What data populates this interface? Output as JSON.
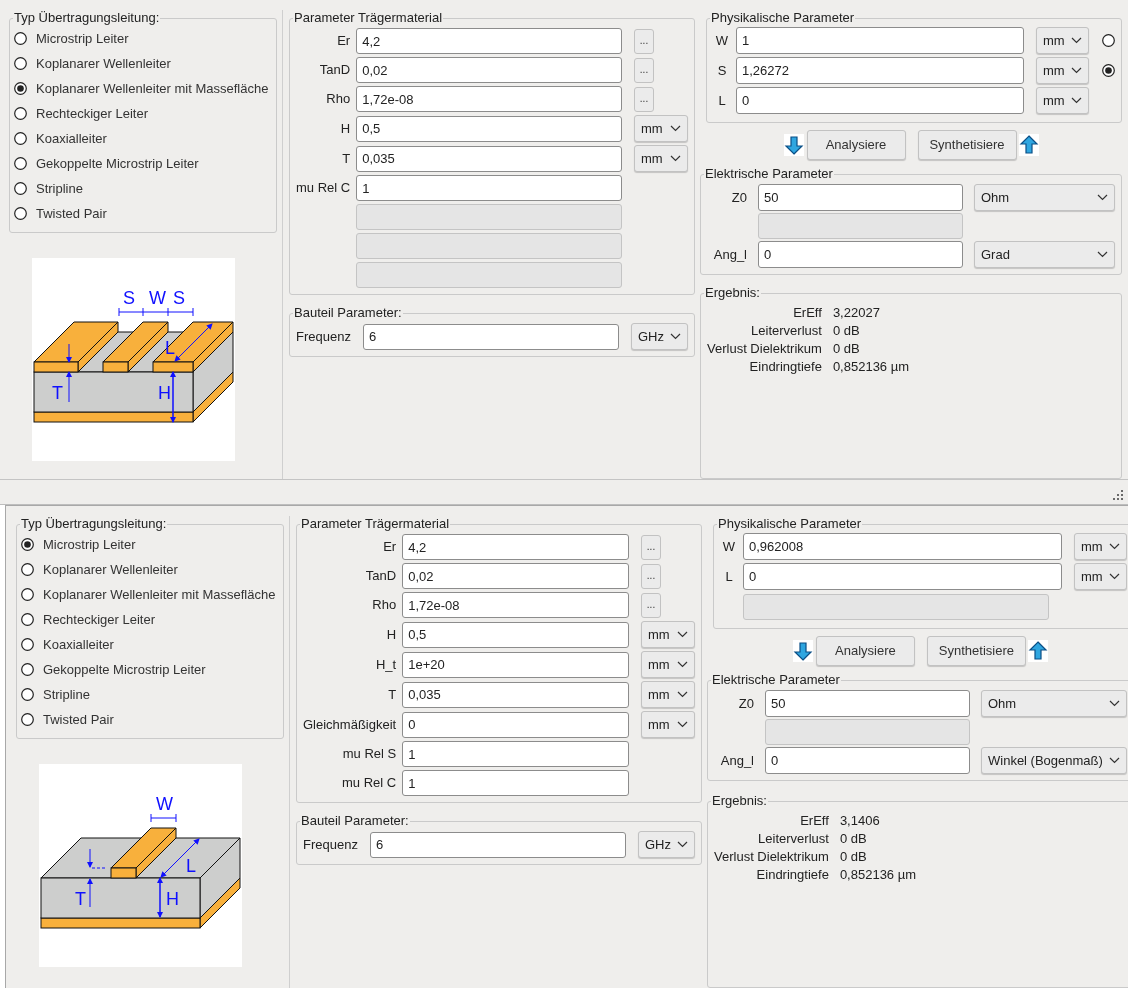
{
  "panels": [
    {
      "line_type": {
        "title": "Typ Übertragungsleitung:",
        "options": [
          {
            "label": "Microstrip Leiter",
            "selected": false
          },
          {
            "label": "Koplanarer Wellenleiter",
            "selected": false
          },
          {
            "label": "Koplanarer Wellenleiter mit Massefläche",
            "selected": true
          },
          {
            "label": "Rechteckiger Leiter",
            "selected": false
          },
          {
            "label": "Koaxialleiter",
            "selected": false
          },
          {
            "label": "Gekoppelte Microstrip Leiter",
            "selected": false
          },
          {
            "label": "Stripline",
            "selected": false
          },
          {
            "label": "Twisted Pair",
            "selected": false
          }
        ]
      },
      "diagram": {
        "kind": "coplanar",
        "s_left": "S",
        "w": "W",
        "s_right": "S",
        "l": "L",
        "t": "T",
        "h": "H"
      },
      "substrate": {
        "title": "Parameter Trägermaterial",
        "rows": [
          {
            "kind": "dots",
            "label": "Er",
            "value": "4,2",
            "button": "..."
          },
          {
            "kind": "dots",
            "label": "TanD",
            "value": "0,02",
            "button": "..."
          },
          {
            "kind": "dots",
            "label": "Rho",
            "value": "1,72e-08",
            "button": "..."
          },
          {
            "kind": "unit",
            "label": "H",
            "value": "0,5",
            "unit": "mm"
          },
          {
            "kind": "unit",
            "label": "T",
            "value": "0,035",
            "unit": "mm"
          },
          {
            "kind": "plain",
            "label": "mu Rel C",
            "value": "1"
          },
          {
            "kind": "blank"
          },
          {
            "kind": "blank"
          },
          {
            "kind": "blank"
          }
        ]
      },
      "component": {
        "title": "Bauteil Parameter:",
        "label": "Frequenz",
        "value": "6",
        "unit": "GHz"
      },
      "physical": {
        "title": "Physikalische Parameter",
        "rows": [
          {
            "kind": "field",
            "label": "W",
            "value": "1",
            "unit": "mm",
            "selected": false
          },
          {
            "kind": "field",
            "label": "S",
            "value": "1,26272",
            "unit": "mm",
            "selected": true
          },
          {
            "kind": "field",
            "label": "L",
            "value": "0",
            "unit": "mm"
          }
        ]
      },
      "actions": {
        "analyze": "Analysiere",
        "synthesize": "Synthetisiere"
      },
      "electrical": {
        "title": "Elektrische Parameter",
        "rows": [
          {
            "kind": "field",
            "label": "Z0",
            "value": "50",
            "unit": "Ohm"
          },
          {
            "kind": "blank"
          },
          {
            "kind": "field",
            "label": "Ang_l",
            "value": "0",
            "unit": "Grad"
          }
        ]
      },
      "results": {
        "title": "Ergebnis:",
        "rows": [
          {
            "label": "ErEff",
            "value": "3,22027"
          },
          {
            "label": "Leiterverlust",
            "value": "0 dB"
          },
          {
            "label": "Verlust Dielektrikum",
            "value": "0 dB"
          },
          {
            "label": "Eindringtiefe",
            "value": "0,852136 µm"
          }
        ]
      }
    },
    {
      "line_type": {
        "title": "Typ Übertragungsleitung:",
        "options": [
          {
            "label": "Microstrip Leiter",
            "selected": true
          },
          {
            "label": "Koplanarer Wellenleiter",
            "selected": false
          },
          {
            "label": "Koplanarer Wellenleiter mit Massefläche",
            "selected": false
          },
          {
            "label": "Rechteckiger Leiter",
            "selected": false
          },
          {
            "label": "Koaxialleiter",
            "selected": false
          },
          {
            "label": "Gekoppelte Microstrip Leiter",
            "selected": false
          },
          {
            "label": "Stripline",
            "selected": false
          },
          {
            "label": "Twisted Pair",
            "selected": false
          }
        ]
      },
      "diagram": {
        "kind": "microstrip",
        "w": "W",
        "l": "L",
        "t": "T",
        "h": "H"
      },
      "substrate": {
        "title": "Parameter Trägermaterial",
        "rows": [
          {
            "kind": "dots",
            "label": "Er",
            "value": "4,2",
            "button": "..."
          },
          {
            "kind": "dots",
            "label": "TanD",
            "value": "0,02",
            "button": "..."
          },
          {
            "kind": "dots",
            "label": "Rho",
            "value": "1,72e-08",
            "button": "..."
          },
          {
            "kind": "unit",
            "label": "H",
            "value": "0,5",
            "unit": "mm"
          },
          {
            "kind": "unit",
            "label": "H_t",
            "value": "1e+20",
            "unit": "mm"
          },
          {
            "kind": "unit",
            "label": "T",
            "value": "0,035",
            "unit": "mm"
          },
          {
            "kind": "unit",
            "label": "Gleichmäßigkeit",
            "value": "0",
            "unit": "mm"
          },
          {
            "kind": "plain",
            "label": "mu Rel S",
            "value": "1"
          },
          {
            "kind": "plain",
            "label": "mu Rel C",
            "value": "1"
          }
        ]
      },
      "component": {
        "title": "Bauteil Parameter:",
        "label": "Frequenz",
        "value": "6",
        "unit": "GHz"
      },
      "physical": {
        "title": "Physikalische Parameter",
        "rows": [
          {
            "kind": "field",
            "label": "W",
            "value": "0,962008",
            "unit": "mm"
          },
          {
            "kind": "field",
            "label": "L",
            "value": "0",
            "unit": "mm"
          },
          {
            "kind": "blank"
          }
        ]
      },
      "actions": {
        "analyze": "Analysiere",
        "synthesize": "Synthetisiere"
      },
      "electrical": {
        "title": "Elektrische Parameter",
        "rows": [
          {
            "kind": "field",
            "label": "Z0",
            "value": "50",
            "unit": "Ohm"
          },
          {
            "kind": "blank"
          },
          {
            "kind": "field",
            "label": "Ang_l",
            "value": "0",
            "unit": "Winkel (Bogenmaß)"
          }
        ]
      },
      "results": {
        "title": "Ergebnis:",
        "rows": [
          {
            "label": "ErEff",
            "value": "3,1406"
          },
          {
            "label": "Leiterverlust",
            "value": "0 dB"
          },
          {
            "label": "Verlust Dielektrikum",
            "value": "0 dB"
          },
          {
            "label": "Eindringtiefe",
            "value": "0,852136 µm"
          }
        ]
      }
    }
  ]
}
